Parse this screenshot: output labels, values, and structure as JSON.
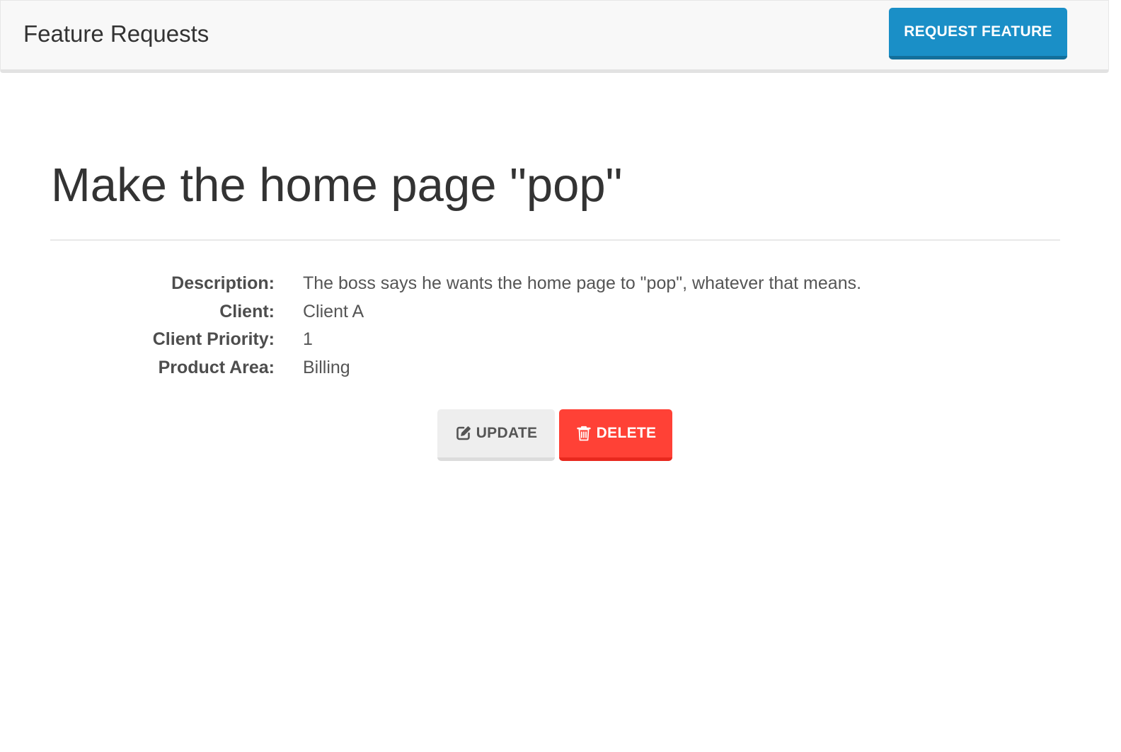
{
  "navbar": {
    "brand": "Feature Requests",
    "request_button": "REQUEST FEATURE"
  },
  "feature": {
    "title": "Make the home page \"pop\"",
    "details": [
      {
        "label": "Description:",
        "value": "The boss says he wants the home page to \"pop\", whatever that means."
      },
      {
        "label": "Client:",
        "value": "Client A"
      },
      {
        "label": "Client Priority:",
        "value": "1"
      },
      {
        "label": "Product Area:",
        "value": "Billing"
      }
    ]
  },
  "actions": {
    "update_label": "UPDATE",
    "update_icon": "edit-icon",
    "delete_label": "DELETE",
    "delete_icon": "trash-icon"
  },
  "colors": {
    "primary": "#1a8fc7",
    "danger": "#ff4136",
    "default_button": "#eeeeee",
    "navbar_bg": "#f8f8f8"
  }
}
